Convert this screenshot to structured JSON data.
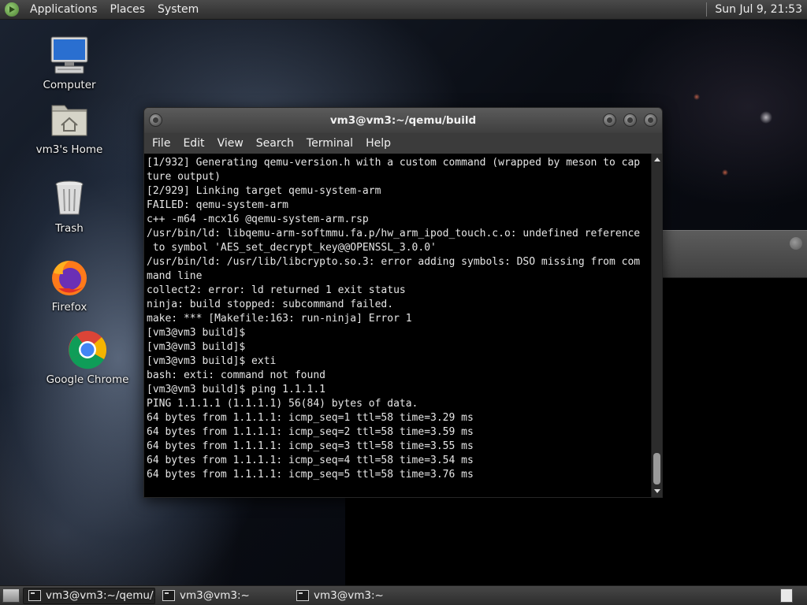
{
  "top_panel": {
    "menus": [
      "Applications",
      "Places",
      "System"
    ],
    "clock": "Sun Jul  9, 21:53"
  },
  "desktop_icons": [
    {
      "label": "Computer",
      "icon": "computer-icon"
    },
    {
      "label": "vm3's Home",
      "icon": "home-folder-icon"
    },
    {
      "label": "Trash",
      "icon": "trash-icon"
    },
    {
      "label": "Firefox",
      "icon": "firefox-icon"
    },
    {
      "label": "Google Chrome",
      "icon": "chrome-icon"
    }
  ],
  "terminal": {
    "title": "vm3@vm3:~/qemu/build",
    "menu": [
      "File",
      "Edit",
      "View",
      "Search",
      "Terminal",
      "Help"
    ],
    "lines": [
      "[1/932] Generating qemu-version.h with a custom command (wrapped by meson to cap",
      "ture output)",
      "[2/929] Linking target qemu-system-arm",
      "FAILED: qemu-system-arm",
      "c++ -m64 -mcx16 @qemu-system-arm.rsp",
      "/usr/bin/ld: libqemu-arm-softmmu.fa.p/hw_arm_ipod_touch.c.o: undefined reference",
      " to symbol 'AES_set_decrypt_key@@OPENSSL_3.0.0'",
      "/usr/bin/ld: /usr/lib/libcrypto.so.3: error adding symbols: DSO missing from com",
      "mand line",
      "collect2: error: ld returned 1 exit status",
      "ninja: build stopped: subcommand failed.",
      "make: *** [Makefile:163: run-ninja] Error 1",
      "[vm3@vm3 build]$",
      "[vm3@vm3 build]$",
      "[vm3@vm3 build]$ exti",
      "bash: exti: command not found",
      "[vm3@vm3 build]$ ping 1.1.1.1",
      "PING 1.1.1.1 (1.1.1.1) 56(84) bytes of data.",
      "64 bytes from 1.1.1.1: icmp_seq=1 ttl=58 time=3.29 ms",
      "64 bytes from 1.1.1.1: icmp_seq=2 ttl=58 time=3.59 ms",
      "64 bytes from 1.1.1.1: icmp_seq=3 ttl=58 time=3.55 ms",
      "64 bytes from 1.1.1.1: icmp_seq=4 ttl=58 time=3.54 ms",
      "64 bytes from 1.1.1.1: icmp_seq=5 ttl=58 time=3.76 ms"
    ]
  },
  "taskbar": {
    "tasks": [
      {
        "label": "vm3@vm3:~/qemu/...",
        "active": true
      },
      {
        "label": "vm3@vm3:~",
        "active": false
      },
      {
        "label": "vm3@vm3:~",
        "active": false
      }
    ]
  }
}
